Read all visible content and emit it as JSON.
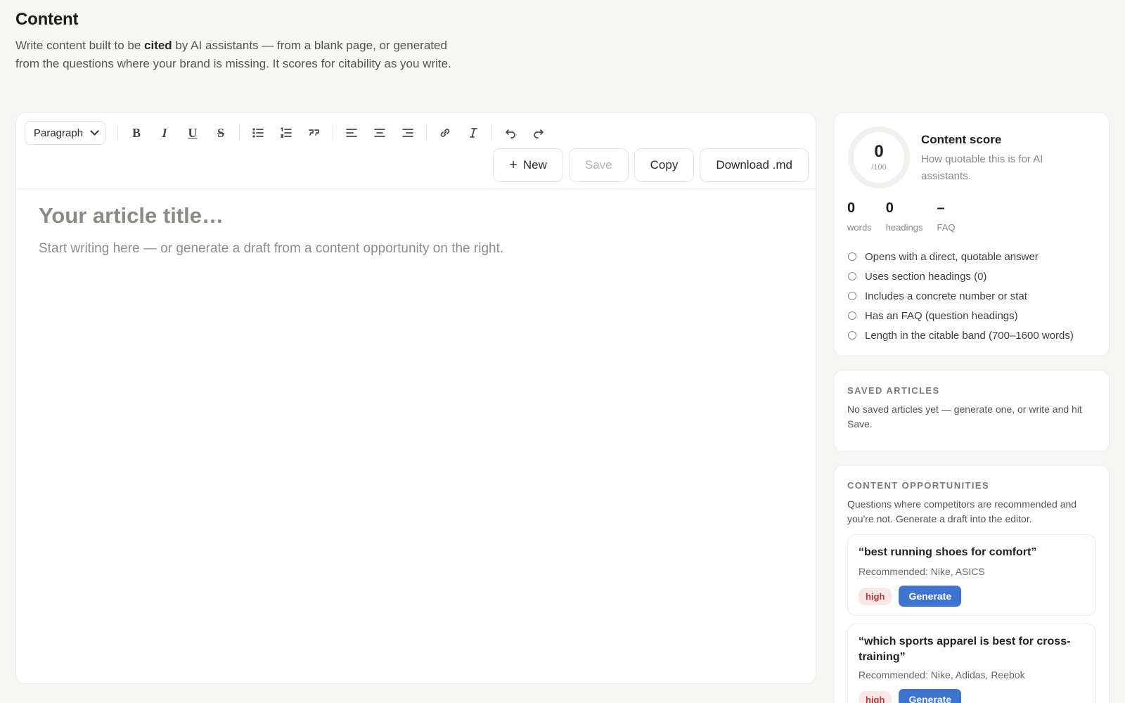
{
  "header": {
    "title": "Content",
    "desc_before": "Write content built to be ",
    "desc_bold": "cited",
    "desc_after": " by AI assistants — from a blank page, or generated from the questions where your brand is missing. It scores for citability as you write."
  },
  "toolbar": {
    "block_type": "Paragraph",
    "buttons": [
      "bold-icon",
      "italic-icon",
      "underline-icon",
      "strikethrough-icon",
      "bullet-list-icon",
      "numbered-list-icon",
      "quote-icon",
      "align-left-icon",
      "align-center-icon",
      "align-right-icon",
      "link-icon",
      "clear-format-icon",
      "undo-icon",
      "redo-icon"
    ],
    "new_label": "New",
    "save_label": "Save",
    "copy_label": "Copy",
    "download_label": "Download .md"
  },
  "editor": {
    "title_placeholder": "Your article title…",
    "body_placeholder": "Start writing here — or generate a draft from a content opportunity on the right."
  },
  "score": {
    "value": "0",
    "max": "/100",
    "title": "Content score",
    "subtitle": "How quotable this is for AI assistants.",
    "stats": [
      {
        "value": "0",
        "label": "words"
      },
      {
        "value": "0",
        "label": "headings"
      },
      {
        "value": "–",
        "label": "FAQ"
      }
    ],
    "checks": [
      "Opens with a direct, quotable answer",
      "Uses section headings (0)",
      "Includes a concrete number or stat",
      "Has an FAQ (question headings)",
      "Length in the citable band (700–1600 words)"
    ]
  },
  "saved": {
    "label": "SAVED ARTICLES",
    "empty_text": "No saved articles yet — generate one, or write and hit Save."
  },
  "opportunities": {
    "label": "CONTENT OPPORTUNITIES",
    "desc": "Questions where competitors are recommended and you're not. Generate a draft into the editor.",
    "items": [
      {
        "question": "“best running shoes for comfort”",
        "recommended": "Recommended: Nike, ASICS",
        "priority": "high",
        "button": "Generate"
      },
      {
        "question": "“which sports apparel is best for cross-training”",
        "recommended": "Recommended: Nike, Adidas, Reebok",
        "priority": "high",
        "button": "Generate"
      }
    ]
  },
  "colors": {
    "accent": "#3e74d0",
    "high_tag_bg": "#f8e7e6",
    "high_tag_text": "#b43a35"
  }
}
